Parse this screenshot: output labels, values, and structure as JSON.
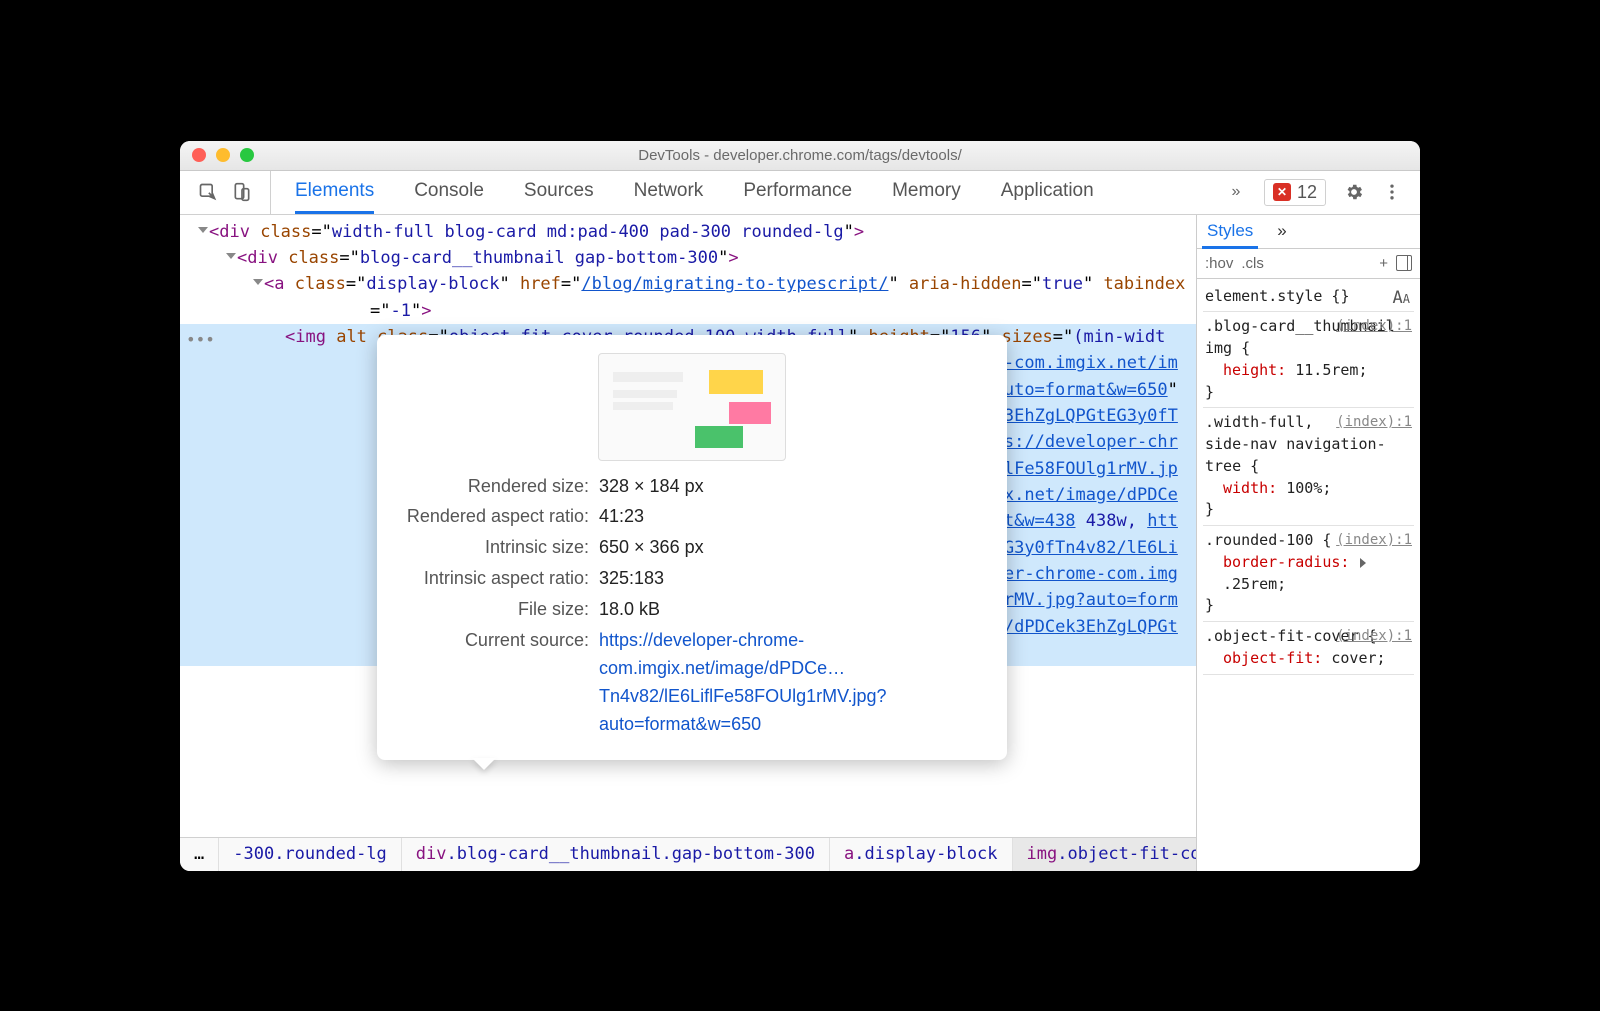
{
  "window": {
    "title": "DevTools - developer.chrome.com/tags/devtools/"
  },
  "tabs": {
    "items": [
      "Elements",
      "Console",
      "Sources",
      "Network",
      "Performance",
      "Memory",
      "Application"
    ],
    "active_index": 0,
    "error_count": "12"
  },
  "dom": {
    "lines": [
      {
        "lvl": "l1",
        "hl": false,
        "html": "<span class='triangle'></span><span class='tag'>&lt;div</span> <span class='attr-name'>class</span>=\"<span class='attr-val'>width-full blog-card md:pad-400 pad-300 rounded-lg</span>\"<span class='tag'>&gt;</span>"
      },
      {
        "lvl": "l2",
        "hl": false,
        "html": "<span class='triangle'></span><span class='tag'>&lt;div</span> <span class='attr-name'>class</span>=\"<span class='attr-val'>blog-card__thumbnail gap-bottom-300</span>\"<span class='tag'>&gt;</span>"
      },
      {
        "lvl": "l3",
        "hl": false,
        "html": "<span class='triangle'></span><span class='tag'>&lt;a</span> <span class='attr-name'>class</span>=\"<span class='attr-val'>display-block</span>\" <span class='attr-name'>href</span>=\"<span class='link'>/blog/migrating-to-typescript/</span>\" <span class='attr-name'>aria-hidden</span>=\"<span class='attr-val'>true</span>\" <span class='attr-name'>tabindex</span>=\"<span class='attr-val'>-1</span>\"<span class='tag'>&gt;</span>"
      },
      {
        "lvl": "l4",
        "hl": true,
        "html": "<span class='tag'>&lt;img</span> <span class='attr-name'>alt</span> <span class='attr-name'>class</span>=\"<span class='attr-val'>object-fit-cover rounded-100 width-full</span>\" <span class='attr-name'>height</span>=\"<span class='attr-val'>156</span>\" <span class='attr-name'>sizes</span>=\"<span class='attr-val'>(min-width: 480px) calc(100vw - 82px)</span>\" <span class='attr-name'>src</span>=\"<span class='link'>https://developer-chrome-com.imgix.net/image/dPDCek3EhZgLQPGtEG3y0fTn4v82/lE6LiflFe58FOUlg1rMV.jpg?auto=format&amp;w=650</span>\" <span class='attr-name'>srcset</span>=\"<span class='link'>https://developer-chrome-com.imgix.net/image/dPDCek3EhZgLQPGtEG3y0fTn4v82/lE6LiflFe58FOUlg1rMV.jpg?auto=format&amp;w=296</span> <span class='attr-val'>296w,</span> <span class='link'>https://developer-chrome-com.imgix.net/image/dPDCek3EhZgLQPGtEG3y0fTn4v82/lE6LiflFe58FOUlg1rMV.jpg?auto=format&amp;w=343</span> <span class='attr-val'>343w,</span> <span class='link'>https://developer-chrome-com.imgix.net/image/dPDCek3EhZgLQPGtEG3y0fTn4v82/lE6LiflFe58FOUlg1rMV.jpg?auto=format&amp;w=438</span> <span class='attr-val'>438w,</span> <span class='link'>https://developer-chrome-com.imgix.net/image/dPDCek3EhZgLQPGtEG3y0fTn4v82/lE6LiflFe58FOUlg1rMV.jpg?auto=format&amp;w=500</span> <span class='attr-val'>500w,</span> <span class='link'>https://developer-chrome-com.imgix.net/image/dPDCek3EhZgLQPGtEG3y0fTn4v82/lE6LiflFe58FOUlg1rMV.jpg?auto=format&amp;w=570</span> <span class='attr-val'>570w,</span> <span class='link'>https://developer-chrome-com.imgix.net/image/dPDCek3EhZgLQPGtEG3y0fTn4v82/lE6L</span>"
      }
    ]
  },
  "hover": {
    "rendered_size_label": "Rendered size:",
    "rendered_size": "328 × 184 px",
    "rendered_ar_label": "Rendered aspect ratio:",
    "rendered_ar": "41:23",
    "intrinsic_size_label": "Intrinsic size:",
    "intrinsic_size": "650 × 366 px",
    "intrinsic_ar_label": "Intrinsic aspect ratio:",
    "intrinsic_ar": "325:183",
    "file_size_label": "File size:",
    "file_size": "18.0 kB",
    "source_label": "Current source:",
    "source": "https://developer-chrome-com.imgix.net/image/dPDCe…Tn4v82/lE6LiflFe58FOUlg1rMV.jpg?auto=format&w=650"
  },
  "breadcrumb": {
    "dots": "…",
    "items": [
      {
        "txt": "-300.rounded-lg",
        "sel": false
      },
      {
        "txt": "div.blog-card__thumbnail.gap-bottom-300",
        "sel": false
      },
      {
        "txt": "a.display-block",
        "sel": false
      },
      {
        "txt": "img.object-fit-cover",
        "sel": true
      }
    ],
    "trail": "…"
  },
  "styles": {
    "tab_label": "Styles",
    "hov": ":hov",
    "cls": ".cls",
    "plus": "+",
    "rules": [
      {
        "selector": "element.style {",
        "props": [],
        "close": "}",
        "src": ""
      },
      {
        "selector": ".blog-card__thumbnail img {",
        "props": [
          {
            "n": "height",
            "v": "11.5rem;"
          }
        ],
        "close": "}",
        "src": "(index):1"
      },
      {
        "selector": ".width-full, side-nav navigation-tree {",
        "props": [
          {
            "n": "width",
            "v": "100%;"
          }
        ],
        "close": "}",
        "src": "(index):1"
      },
      {
        "selector": ".rounded-100 {",
        "props": [
          {
            "n": "border-radius",
            "v": "▸ .25rem;"
          }
        ],
        "close": "}",
        "src": "(index):1"
      },
      {
        "selector": ".object-fit-cover {",
        "props": [
          {
            "n": "object-fit",
            "v": "cover;"
          }
        ],
        "close": "",
        "src": "(index):1"
      }
    ]
  }
}
